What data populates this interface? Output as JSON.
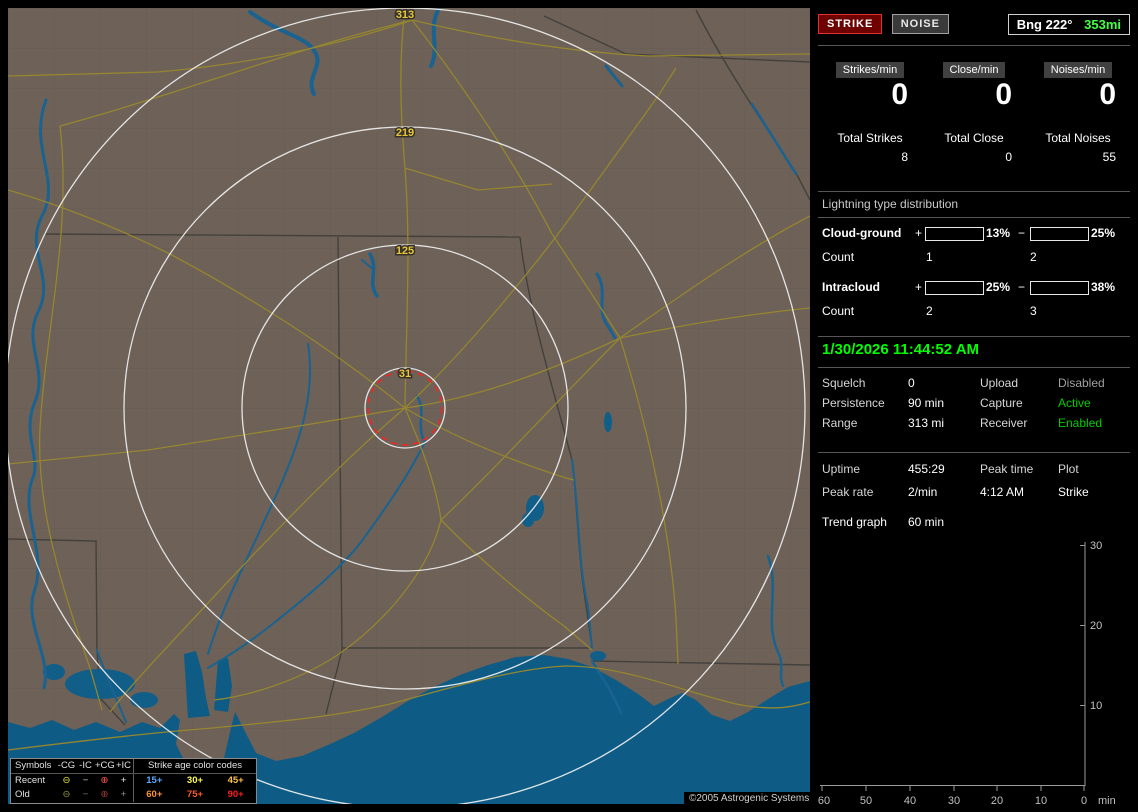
{
  "window": {
    "copyright": "©2005 Astrogenic Systems"
  },
  "map": {
    "range_labels": [
      "313",
      "219",
      "125",
      "31"
    ],
    "colors": {
      "land": "#6d6158",
      "water": "#0e5c85",
      "road": "#95862f",
      "range_ring": "#f0f0f0",
      "range_label": "#e6c73c",
      "alarm_ring": "#ff2020"
    },
    "legend": {
      "symbols_header": "Symbols",
      "col_headers": [
        "-CG",
        "-IC",
        "+CG",
        "+IC"
      ],
      "age_header": "Strike age color codes",
      "rows": [
        {
          "label": "Recent",
          "symbols": [
            {
              "glyph": "⊖",
              "color": "#e0dc5a"
            },
            {
              "glyph": "−",
              "color": "#c8c8c8"
            },
            {
              "glyph": "⊕",
              "color": "#ff5555"
            },
            {
              "glyph": "+",
              "color": "#f0f0f0"
            }
          ],
          "ages": [
            {
              "text": "15+",
              "color": "#5aa8ff"
            },
            {
              "text": "30+",
              "color": "#ffff55"
            },
            {
              "text": "45+",
              "color": "#ffc04a"
            }
          ]
        },
        {
          "label": "Old",
          "symbols": [
            {
              "glyph": "⊖",
              "color": "#8f8c3a"
            },
            {
              "glyph": "−",
              "color": "#7d7d7d"
            },
            {
              "glyph": "⊕",
              "color": "#9e3a3a"
            },
            {
              "glyph": "+",
              "color": "#949494"
            }
          ],
          "ages": [
            {
              "text": "60+",
              "color": "#ff9232"
            },
            {
              "text": "75+",
              "color": "#ff5a2a"
            },
            {
              "text": "90+",
              "color": "#ff1e1e"
            }
          ]
        }
      ]
    }
  },
  "panel": {
    "strike_button": "STRIKE",
    "noise_button": "NOISE",
    "bearing_label": "Bng 222°",
    "bearing_distance": "353mi",
    "bearing_distance_color": "#44ff44",
    "rate_boxes": [
      {
        "label": "Strikes/min",
        "value": "0"
      },
      {
        "label": "Close/min",
        "value": "0"
      },
      {
        "label": "Noises/min",
        "value": "0"
      }
    ],
    "totals": [
      {
        "label": "Total Strikes",
        "value": "8"
      },
      {
        "label": "Total Close",
        "value": "0"
      },
      {
        "label": "Total Noises",
        "value": "55"
      }
    ],
    "distribution": {
      "title": "Lightning type distribution",
      "pos_sign": "+",
      "neg_sign": "−",
      "rows": [
        {
          "label": "Cloud-ground",
          "pos_pct": "13%",
          "pos_fill": 13,
          "pos_color": "#ff1010",
          "neg_pct": "25%",
          "neg_fill": 25,
          "neg_color": "#5596dd",
          "count_label": "Count",
          "pos_count": "1",
          "neg_count": "2"
        },
        {
          "label": "Intracloud",
          "pos_pct": "25%",
          "pos_fill": 25,
          "pos_color": "#ff66cc",
          "neg_pct": "38%",
          "neg_fill": 38,
          "neg_color": "#00d040",
          "count_label": "Count",
          "pos_count": "2",
          "neg_count": "3"
        }
      ]
    },
    "datetime": "1/30/2026 11:44:52 AM",
    "datetime_color": "#00ff00",
    "settings": [
      {
        "label": "Squelch",
        "value": "0",
        "label2": "Upload",
        "value2": "Disabled",
        "value2_color": "#a0a0a0"
      },
      {
        "label": "Persistence",
        "value": "90 min",
        "label2": "Capture",
        "value2": "Active",
        "value2_color": "#00cc00"
      },
      {
        "label": "Range",
        "value": "313 mi",
        "label2": "Receiver",
        "value2": "Enabled",
        "value2_color": "#00cc00"
      }
    ],
    "status": {
      "uptime_label": "Uptime",
      "uptime": "455:29",
      "peak_time_label": "Peak time",
      "plot_label": "Plot",
      "peak_rate_label": "Peak rate",
      "peak_rate": "2/min",
      "peak_time": "4:12 AM",
      "plot": "Strike",
      "trend_label": "Trend graph",
      "trend_value": "60 min"
    },
    "graph": {
      "x_ticks": [
        "60",
        "50",
        "40",
        "30",
        "20",
        "10",
        "0"
      ],
      "unit": "min",
      "y_ticks": [
        "30",
        "20",
        "10"
      ]
    }
  },
  "chart_data": {
    "type": "line",
    "title": "Strike trend graph",
    "xlabel": "min",
    "ylabel": "",
    "x": [
      60,
      50,
      40,
      30,
      20,
      10,
      0
    ],
    "ylim": [
      0,
      30
    ],
    "xlim": [
      60,
      0
    ],
    "y_tick_values": [
      30,
      20,
      10
    ],
    "legend_position": "none",
    "grid": false,
    "series": [
      {
        "name": "Strikes/min",
        "values": []
      }
    ]
  }
}
